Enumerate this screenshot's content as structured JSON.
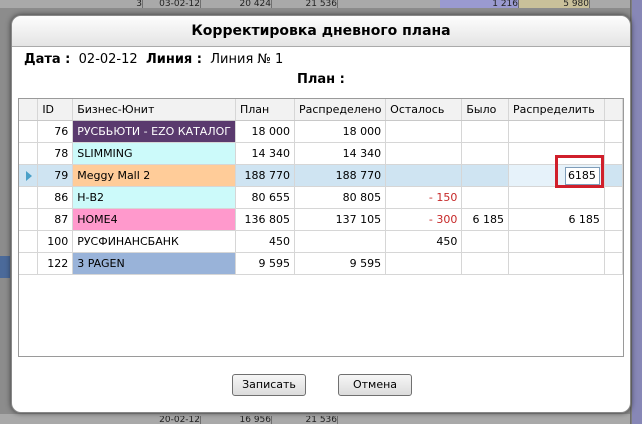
{
  "background": {
    "top_row": [
      "3",
      "03-02-12",
      "20 424",
      "21 536",
      "1 216",
      "5 980"
    ],
    "bottom_row": [
      "20-02-12",
      "16 956",
      "21 536"
    ]
  },
  "dialog": {
    "title": "Корректировка дневного плана",
    "date_label": "Дата :",
    "date_value": "02-02-12",
    "line_label": "Линия :",
    "line_value": "Линия № 1",
    "plan_label": "План :",
    "columns": [
      "ID",
      "Бизнес-Юнит",
      "План",
      "Распределено",
      "Осталось",
      "Было",
      "Распределить"
    ],
    "rows": [
      {
        "id": "76",
        "unit": "РУСБЬЮТИ - EZO КАТАЛОГ",
        "plan": "18 000",
        "distributed": "18 000",
        "left": "",
        "was": "",
        "distribute": "",
        "color": "#5a3a6e",
        "text_color": "#ffffff"
      },
      {
        "id": "78",
        "unit": "SLIMMING",
        "plan": "14 340",
        "distributed": "14 340",
        "left": "",
        "was": "",
        "distribute": "",
        "color": "#ccfafa",
        "text_color": "#000000"
      },
      {
        "id": "79",
        "unit": "Meggy Mall 2",
        "plan": "188 770",
        "distributed": "188 770",
        "left": "",
        "was": "",
        "distribute": "6185",
        "color": "#ffcc99",
        "text_color": "#000000",
        "selected": true
      },
      {
        "id": "86",
        "unit": "Н-В2",
        "plan": "80 655",
        "distributed": "80 805",
        "left": "- 150",
        "was": "",
        "distribute": "",
        "color": "#ccfafa",
        "text_color": "#000000"
      },
      {
        "id": "87",
        "unit": "HOME4",
        "plan": "136 805",
        "distributed": "137 105",
        "left": "- 300",
        "was": "6 185",
        "distribute": "6 185",
        "color": "#ff99cc",
        "text_color": "#000000"
      },
      {
        "id": "100",
        "unit": "РУСФИНАНСБАНК",
        "plan": "450",
        "distributed": "",
        "left": "450",
        "was": "",
        "distribute": "",
        "color": "#ffffff",
        "text_color": "#000000"
      },
      {
        "id": "122",
        "unit": "3 PAGEN",
        "plan": "9 595",
        "distributed": "9 595",
        "left": "",
        "was": "",
        "distribute": "",
        "color": "#99b3d9",
        "text_color": "#000000"
      }
    ],
    "save_label": "Записать",
    "cancel_label": "Отмена"
  }
}
